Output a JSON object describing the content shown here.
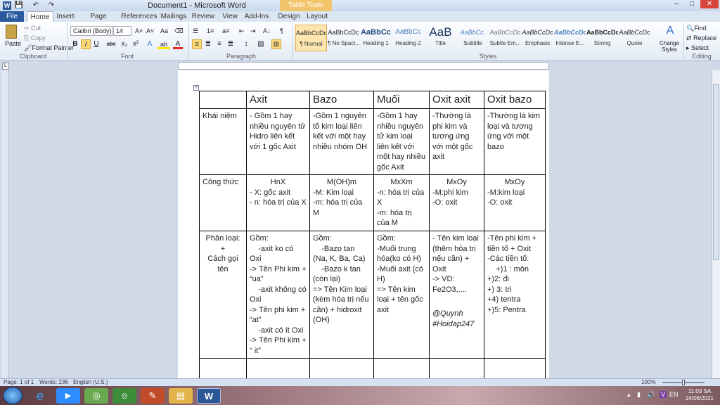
{
  "window": {
    "title": "Document1 - Microsoft Word",
    "context_tab_group": "Table Tools",
    "quick_access": [
      "💾",
      "↶",
      "↷"
    ],
    "controls": [
      "–",
      "□",
      "✕"
    ]
  },
  "tabs": [
    "File",
    "Home",
    "Insert",
    "Page Layout",
    "References",
    "Mailings",
    "Review",
    "View",
    "Add-Ins",
    "Design",
    "Layout"
  ],
  "ribbon": {
    "clipboard": {
      "label": "Clipboard",
      "paste": "Paste",
      "cut": "Cut",
      "copy": "Copy",
      "format_painter": "Format Painter"
    },
    "font": {
      "label": "Font",
      "family": "Calibri (Body)",
      "size": "14",
      "grow": "A˄",
      "shrink": "A˅",
      "change_case": "Aa",
      "clear": "⌫",
      "bold": "B",
      "italic": "I",
      "underline": "U",
      "strike": "abc",
      "sub": "x₂",
      "sup": "x²",
      "effects": "A",
      "highlight": "ab",
      "color": "A"
    },
    "paragraph": {
      "label": "Paragraph",
      "bullets": "☰",
      "numbering": "1≡",
      "multilevel": "a≡",
      "dec_indent": "⇤",
      "inc_indent": "⇥",
      "sort": "A↓",
      "pilcrow": "¶",
      "align": [
        "≡",
        "≣",
        "≡",
        "≣"
      ],
      "spacing": "↕",
      "shading": "▧",
      "borders": "⊞"
    },
    "styles": {
      "label": "Styles",
      "items": [
        {
          "preview": "AaBbCcDc",
          "name": "¶ Normal"
        },
        {
          "preview": "AaBbCcDc",
          "name": "¶ No Spaci..."
        },
        {
          "preview": "AaBbCc",
          "name": "Heading 1"
        },
        {
          "preview": "AaBbCc",
          "name": "Heading 2"
        },
        {
          "preview": "AaB",
          "name": "Title"
        },
        {
          "preview": "AaBbCc.",
          "name": "Subtitle"
        },
        {
          "preview": "AaBbCcDc",
          "name": "Subtle Em..."
        },
        {
          "preview": "AaBbCcDc",
          "name": "Emphasis"
        },
        {
          "preview": "AaBbCcDc",
          "name": "Intense E..."
        },
        {
          "preview": "AaBbCcDc",
          "name": "Strong"
        },
        {
          "preview": "AaBbCcDc",
          "name": "Quote"
        }
      ],
      "change_styles": "Change Styles"
    },
    "editing": {
      "label": "Editing",
      "find": "Find",
      "replace": "Replace",
      "select": "Select"
    }
  },
  "table": {
    "header": [
      "",
      "Axit",
      "Bazo",
      "Muối",
      "Oxit axit",
      "Oxit bazo"
    ],
    "rows": [
      {
        "label": "Khái niệm",
        "cells": [
          "- Gồm 1 hay nhiều nguyên tử Hidro liên kết với 1 gốc Axit",
          "-Gồm 1 nguyên tố kim loại liên kết với một hay nhiều nhóm OH",
          "-Gồm 1 hay nhiều nguyên tử kim loại liên kết với một hay nhiều gốc Axit",
          "-Thường là phi kim và tương ứng với một gốc axit",
          "-Thường là kim loại và tương ứng với một bazo"
        ]
      },
      {
        "label": "Công thức",
        "formulas": [
          "HnX",
          "M(OH)m",
          "MxXm",
          "MxOy",
          "MxOy"
        ],
        "cells": [
          "- X: gốc axit\n- n: hóa trị của X",
          "-M: Kim loại\n-m: hóa trị của M",
          "-n: hóa trị của X\n-m: hóa trị của M",
          "-M:phi kim\n-O: oxit",
          "-M:kim loại\n-O: oxit"
        ]
      },
      {
        "label": "Phân loại:\n+\nCách gọi tên",
        "cells": [
          "Gồm:\n    -axit ko có Oxi\n-> Tên Phi kim + “ua”\n    -axit không có Oxi\n-> Tên phi kim + “at”\n    -axit có ít Oxi\n-> Tên Phi kim + “ it”",
          "Gồm:\n    -Bazo tan (Na, K, Ba, Ca)\n    -Bazo k tan (còn lại)\n=> Tên Kim loại (kèm hóa trị nếu cần) + hidroxit (OH)",
          "Gồm:\n-Muối trung hóa(ko có H)\n-Muối axit (có H)\n=> Tên kim loại + tên gốc axit",
          "- Tên kim loại (thêm hóa trị nếu cần) + Oxit\n-> VD: Fe2O3,....",
          "-Tên phi kim + tiền tố + Oxit\n-Các tiền tố:\n    +)1 : môn\n+)2: đi\n+) 3: tri\n+4) tentra\n+)5: Pentra"
        ],
        "signature": "@Quynh\n#Hoidap247"
      }
    ]
  },
  "status": {
    "page": "Page: 1 of 1",
    "words": "Words: 236",
    "language": "English (U.S.)",
    "zoom": "100%"
  },
  "taskbar": {
    "clock_time": "11:03 SA",
    "clock_date": "24/06/2021",
    "tray_lang": "EN"
  }
}
